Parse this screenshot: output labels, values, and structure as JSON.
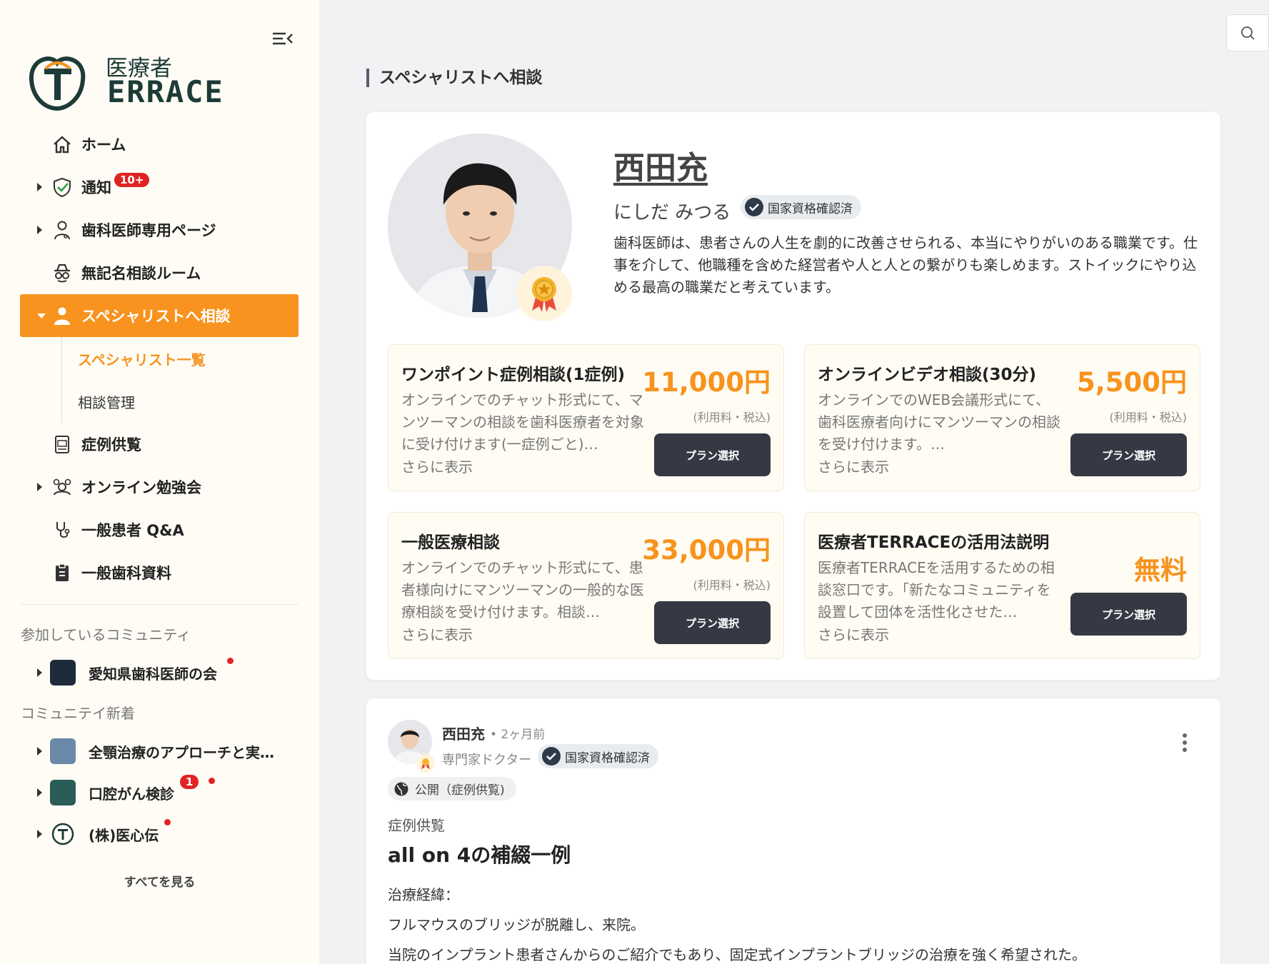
{
  "sidebar": {
    "logo": {
      "top_text": "医療者",
      "bottom_text": "ERRACE",
      "letter": "T"
    },
    "nav": [
      {
        "label": "ホーム",
        "icon": "home-icon"
      },
      {
        "label": "通知",
        "icon": "shield-check-icon",
        "badge": "10+"
      },
      {
        "label": "歯科医師専用ページ",
        "icon": "doctor-icon"
      },
      {
        "label": "無記名相談ルーム",
        "icon": "incognito-icon"
      },
      {
        "label": "スペシャリストへ相談",
        "icon": "specialist-icon"
      }
    ],
    "sub_items": [
      {
        "label": "スペシャリスト一覧"
      },
      {
        "label": "相談管理"
      }
    ],
    "nav2": [
      {
        "label": "症例供覧",
        "icon": "xray-document-icon"
      },
      {
        "label": "オンライン勉強会",
        "icon": "online-study-icon"
      },
      {
        "label": "一般患者 Q&A",
        "icon": "stethoscope-icon"
      },
      {
        "label": "一般歯科資料",
        "icon": "clipboard-icon"
      }
    ],
    "joined_title": "参加しているコミュニティ",
    "joined": [
      {
        "label": "愛知県歯科医師の会",
        "color": "#1e2b3b"
      }
    ],
    "new_title": "コミュニテイ新着",
    "new": [
      {
        "label": "全顎治療のアプローチと実…",
        "color": "#6a88a8"
      },
      {
        "label": "口腔がん検診",
        "color": "#2a5c58",
        "badge": "1"
      },
      {
        "label": "(株)医心伝",
        "color": "#ffffff"
      }
    ],
    "see_all": "すべてを見る"
  },
  "main": {
    "page_title": "スペシャリストへ相談",
    "doctor": {
      "name": "西田充",
      "kana": "にしだ みつる",
      "verified": "国家資格確認済",
      "bio": "歯科医師は、患者さんの人生を劇的に改善させられる、本当にやりがいのある職業です。仕事を介して、他職種を含めた経営者や人と人との繋がりも楽しめます。ストイックにやり込める最高の職業だと考えています。"
    },
    "plans": [
      {
        "title": "ワンポイント症例相談(1症例)",
        "desc": "オンラインでのチャット形式にて、マンツーマンの相談を歯科医療者を対象に受け付けます(一症例ごと)…",
        "more": "さらに表示",
        "price": "11,000円",
        "tax": "(利用料・税込)",
        "button": "プラン選択"
      },
      {
        "title": "オンラインビデオ相談(30分)",
        "desc": "オンラインでのWEB会議形式にて、歯科医療者向けにマンツーマンの相談を受け付けます。…",
        "more": "さらに表示",
        "price": "5,500円",
        "tax": "(利用料・税込)",
        "button": "プラン選択"
      },
      {
        "title": "一般医療相談",
        "desc": "オンラインでのチャット形式にて、患者様向けにマンツーマンの一般的な医療相談を受け付けます。相談…",
        "more": "さらに表示",
        "price": "33,000円",
        "tax": "(利用料・税込)",
        "button": "プラン選択"
      },
      {
        "title": "医療者TERRACEの活用法説明",
        "desc": "医療者TERRACEを活用するための相談窓口です。「新たなコミュニティを設置して団体を活性化させた…",
        "more": "さらに表示",
        "price": "無料",
        "tax": "",
        "button": "プラン選択"
      }
    ],
    "post": {
      "author": "西田充",
      "time": "• 2ヶ月前",
      "role": "専門家ドクター",
      "verified": "国家資格確認済",
      "visibility": "公開（症例供覧)",
      "category": "症例供覧",
      "title": "all on 4の補綴一例",
      "body_heading": "治療経緯：",
      "body_line1": "フルマウスのブリッジが脱離し、来院。",
      "body_line2": "当院のインプラント患者さんからのご紹介でもあり、固定式インプラントブリッジの治療を強く希望された。"
    }
  },
  "colors": {
    "accent": "#f7931e",
    "dark_button": "#343944",
    "badge": "#e02424",
    "logo": "#1d3b37"
  }
}
